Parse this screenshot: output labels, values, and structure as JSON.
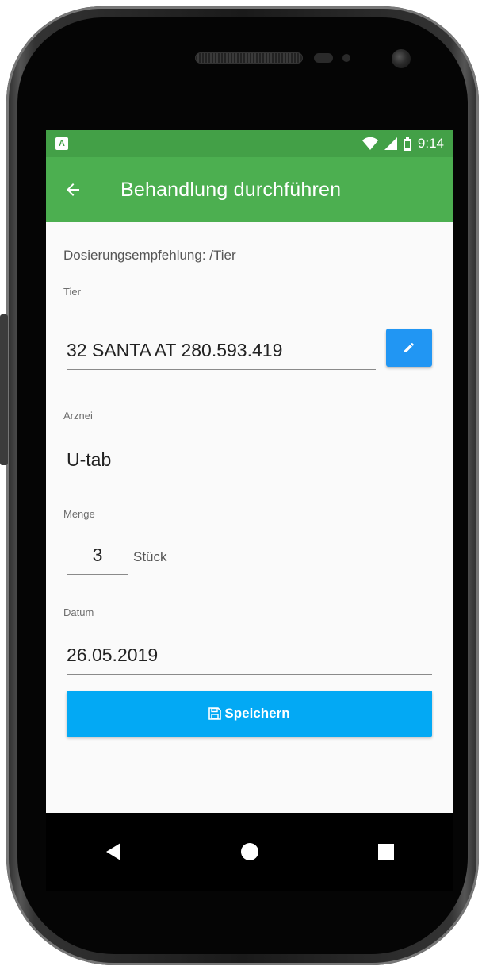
{
  "status_bar": {
    "time": "9:14",
    "notification_icon": "notification-a-icon",
    "wifi_icon": "wifi-icon",
    "signal_icon": "signal-icon",
    "battery_icon": "battery-icon",
    "notification_letter": "A"
  },
  "app_bar": {
    "title": "Behandlung durchführen",
    "back_icon": "arrow-back-icon"
  },
  "form": {
    "dosage_hint": "Dosierungsempfehlung: /Tier",
    "animal_label": "Tier",
    "animal_value": "32  SANTA  AT 280.593.419",
    "edit_icon": "pencil-icon",
    "medicine_label": "Arznei",
    "medicine_value": "U-tab",
    "quantity_label": "Menge",
    "quantity_value": "3",
    "quantity_unit": "Stück",
    "date_label": "Datum",
    "date_value": "26.05.2019",
    "save_label": "Speichern",
    "save_icon": "floppy-disk-icon"
  },
  "colors": {
    "status_bar": "#43a047",
    "app_bar": "#4caf50",
    "edit_button": "#2196f3",
    "save_button": "#03a9f4"
  },
  "nav_bar": {
    "back_icon": "nav-back-triangle-icon",
    "home_icon": "nav-home-circle-icon",
    "recents_icon": "nav-recents-square-icon"
  }
}
